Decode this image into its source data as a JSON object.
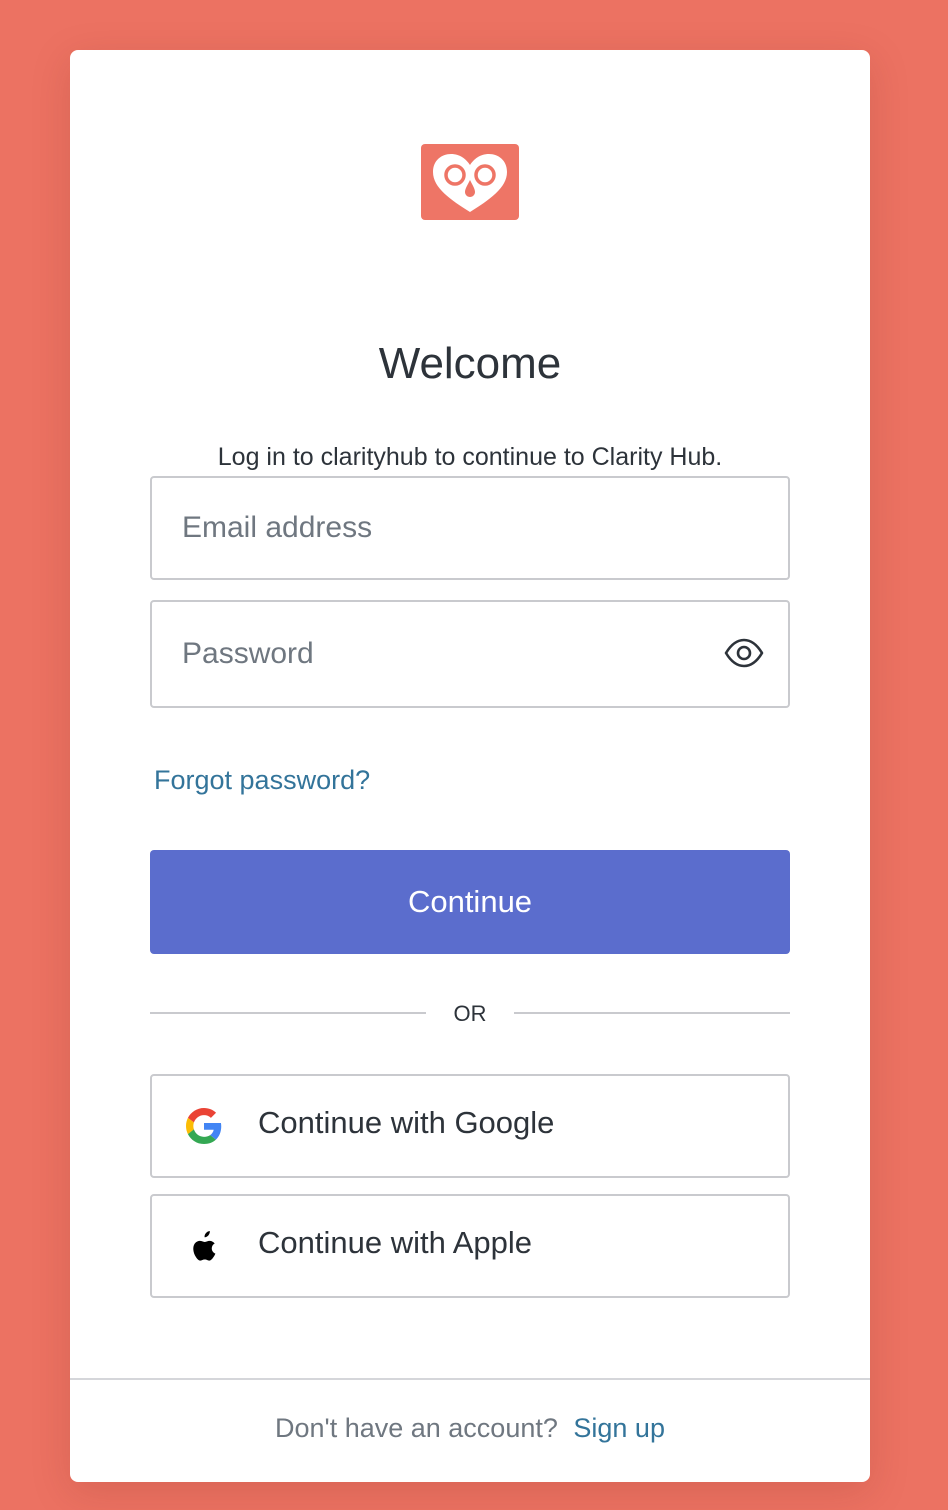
{
  "page": {
    "title": "Welcome",
    "subtitle": "Log in to clarityhub to continue to Clarity Hub."
  },
  "logo": {
    "icon": "owl-heart-logo",
    "color": "#ee7566"
  },
  "form": {
    "email_placeholder": "Email address",
    "password_placeholder": "Password",
    "show_password_icon": "eye-icon",
    "forgot_label": "Forgot password?",
    "continue_label": "Continue"
  },
  "divider": {
    "label": "OR"
  },
  "social": {
    "google_label": "Continue with Google",
    "apple_label": "Continue with Apple"
  },
  "footer": {
    "question": "Don't have an account?",
    "signup_label": "Sign up"
  },
  "colors": {
    "background": "#ec7262",
    "primary": "#5b6dcd",
    "link": "#33749a",
    "text": "#2d333a"
  }
}
